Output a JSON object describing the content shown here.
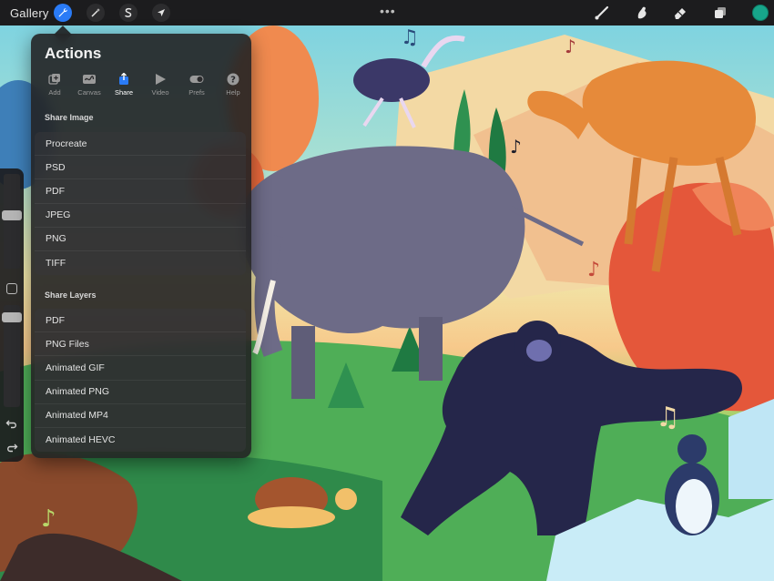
{
  "topbar": {
    "gallery_label": "Gallery",
    "left_tools": [
      {
        "name": "actions-icon",
        "active": true
      },
      {
        "name": "adjustments-icon",
        "active": false
      },
      {
        "name": "selection-icon",
        "active": false
      },
      {
        "name": "transform-icon",
        "active": false
      }
    ],
    "more_label": "•••",
    "right_tools": [
      "brush-icon",
      "smudge-icon",
      "eraser-icon",
      "layers-icon"
    ],
    "current_color": "#17a58a",
    "accent_color": "#2a7bf6"
  },
  "actions_panel": {
    "title": "Actions",
    "tabs": [
      {
        "label": "Add",
        "icon": "add-icon"
      },
      {
        "label": "Canvas",
        "icon": "canvas-icon"
      },
      {
        "label": "Share",
        "icon": "share-icon",
        "active": true
      },
      {
        "label": "Video",
        "icon": "video-icon"
      },
      {
        "label": "Prefs",
        "icon": "prefs-toggle-icon"
      },
      {
        "label": "Help",
        "icon": "help-icon"
      }
    ],
    "share_image": {
      "heading": "Share Image",
      "items": [
        "Procreate",
        "PSD",
        "PDF",
        "JPEG",
        "PNG",
        "TIFF"
      ]
    },
    "share_layers": {
      "heading": "Share Layers",
      "items": [
        "PDF",
        "PNG Files",
        "Animated GIF",
        "Animated PNG",
        "Animated MP4",
        "Animated HEVC"
      ]
    }
  },
  "sidebar": {
    "controls": [
      "brush-size-slider",
      "modify-button",
      "opacity-slider",
      "undo-icon",
      "redo-icon"
    ]
  }
}
